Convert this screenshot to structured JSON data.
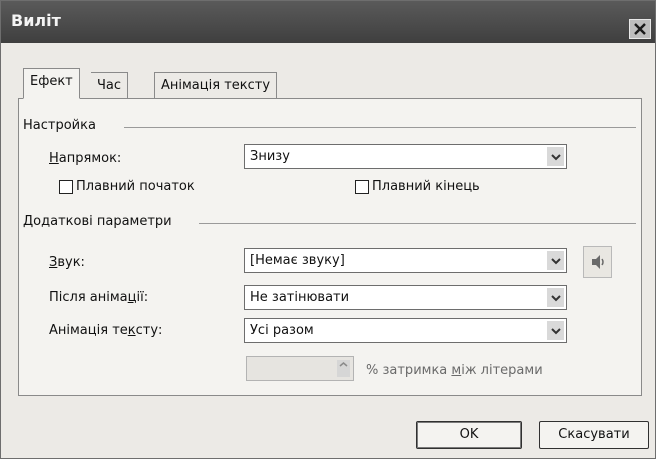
{
  "dialog": {
    "title": "Виліт"
  },
  "tabs": [
    {
      "label": "Ефект",
      "active": true
    },
    {
      "label": "Час",
      "active": false
    },
    {
      "label": "Анімація тексту",
      "active": false
    }
  ],
  "settings": {
    "group_label": "Настройка",
    "direction": {
      "label_prefix": "",
      "label_mnemonic": "Н",
      "label_rest": "апрямок:",
      "value": "Знизу"
    },
    "smooth_start": {
      "label": "Плавний початок",
      "checked": false
    },
    "smooth_end": {
      "label": "Плавний кінець",
      "checked": false
    }
  },
  "extra": {
    "group_label": "Додаткові параметри",
    "sound": {
      "label_mnemonic": "З",
      "label_rest": "вук:",
      "value": "[Немає звуку]"
    },
    "after_animation": {
      "label_prefix": "Після аніма",
      "label_mnemonic": "ц",
      "label_rest": "ії:",
      "value": "Не затінювати"
    },
    "animate_text": {
      "label_prefix": "Анімація те",
      "label_mnemonic": "к",
      "label_rest": "сту:",
      "value": "Усі разом"
    },
    "delay": {
      "value": "",
      "label_prefix": "% затримка ",
      "label_mnemonic": "м",
      "label_rest": "іж літерами"
    }
  },
  "buttons": {
    "ok": "OK",
    "cancel": "Скасувати"
  },
  "icons": {
    "close": "close-icon",
    "dropdown": "chevron-down-icon",
    "sound_play": "speaker-icon",
    "spinner": "spinner-arrows-icon"
  },
  "colors": {
    "title_bar": "#4a4a4a",
    "dialog_bg": "#eceae6",
    "panel_bg": "#f4f3f0"
  }
}
